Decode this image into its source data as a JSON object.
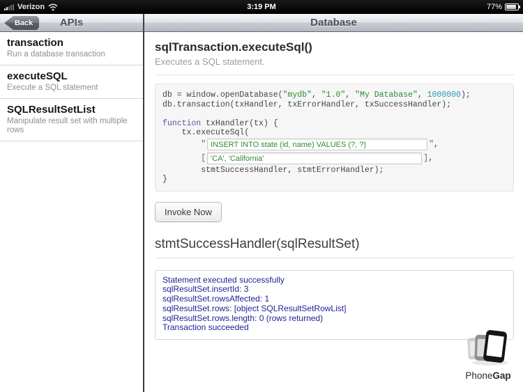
{
  "status_bar": {
    "carrier": "Verizon",
    "time": "3:19 PM",
    "battery_percent": "77%"
  },
  "nav": {
    "back_label": "Back",
    "left_title": "APIs",
    "right_title": "Database"
  },
  "sidebar": {
    "items": [
      {
        "title": "transaction",
        "subtitle": "Run a database transaction"
      },
      {
        "title": "executeSQL",
        "subtitle": "Execute a SQL statement"
      },
      {
        "title": "SQLResultSetList",
        "subtitle": "Manipulate result set with multiple rows"
      }
    ]
  },
  "main": {
    "title": "sqlTransaction.executeSql()",
    "subtitle": "Executes a SQL statement.",
    "code": {
      "l1": {
        "p1": "db = window.openDatabase(",
        "s1": "\"mydb\"",
        "p2": ", ",
        "s2": "\"1.0\"",
        "p3": ", ",
        "s3": "\"My Database\"",
        "p4": ", ",
        "n1": "1000000",
        "p5": ");"
      },
      "l2": "db.transaction(txHandler, txErrorHandler, txSuccessHandler);",
      "l3": " ",
      "l4": {
        "k1": "function",
        "p1": " txHandler(tx) {"
      },
      "l5": "    tx.executeSql(",
      "l6": {
        "indent": "        ",
        "q1": "\"",
        "q2": "\"",
        "comma": ","
      },
      "l7": {
        "indent": "        ",
        "b1": "[",
        "b2": "]",
        "comma": ","
      },
      "l8": "        stmtSuccessHandler, stmtErrorHandler);",
      "l9": "}"
    },
    "inputs": {
      "sql_statement": "INSERT INTO state (id, name) VALUES (?, ?)",
      "sql_params": "'CA', 'California'"
    },
    "invoke_label": "Invoke Now",
    "handler_title": "stmtSuccessHandler(sqlResultSet)",
    "output_lines": [
      "Statement executed successfully",
      "sqlResultSet.insertId: 3",
      "sqlResultSet.rowsAffected: 1",
      "sqlResultSet.rows: [object SQLResultSetRowList]",
      "sqlResultSet.rows.length: 0 (rows returned)",
      "Transaction succeeded"
    ]
  },
  "logo": {
    "brand_regular": "Phone",
    "brand_bold": "Gap"
  },
  "colors": {
    "code_string_green": "#2e8b33",
    "code_keyword_purple": "#5a55a0",
    "code_literal_blue": "#2b93b5",
    "output_navy": "#1e1e96",
    "nav_silver": "#c9cdd3",
    "statusbar_black": "#000000"
  }
}
